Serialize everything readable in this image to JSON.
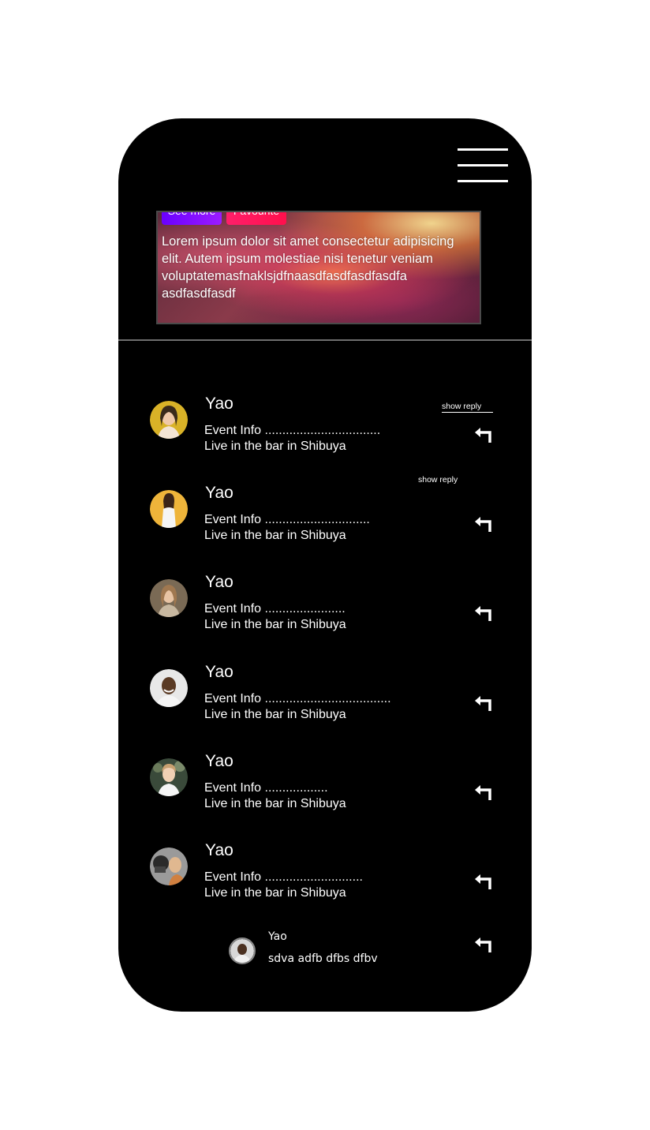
{
  "banner": {
    "see_more_label": "See more",
    "favourite_label": "Favourite",
    "description": "Lorem ipsum dolor sit amet consectetur adipisicing elit. Autem ipsum molestiae nisi tenetur veniam voluptatemasfnaklsjdfnaasdfasdfasdfasdfa asdfasdfasdf"
  },
  "comments": [
    {
      "name": "Yao",
      "info": "Event Info .................................",
      "detail": "Live in the bar in Shibuya",
      "show_reply": "show reply",
      "avatar_color": "#d9b227"
    },
    {
      "name": "Yao",
      "info": "Event Info ..............................",
      "detail": "Live in the bar in Shibuya",
      "show_reply": "show reply",
      "avatar_color": "#eeb43a"
    },
    {
      "name": "Yao",
      "info": "Event Info .......................",
      "detail": "Live in the bar in Shibuya",
      "avatar_color": "#7a6a55"
    },
    {
      "name": "Yao",
      "info": "Event Info ....................................",
      "detail": "Live in the bar in Shibuya",
      "avatar_color": "#e8e8e8"
    },
    {
      "name": "Yao",
      "info": "Event Info ..................",
      "detail": "Live in the bar in Shibuya",
      "avatar_color": "#5a6a5a"
    },
    {
      "name": "Yao",
      "info": "Event Info ............................",
      "detail": "Live in the bar in Shibuya",
      "avatar_color": "#8a8a8a"
    }
  ],
  "reply": {
    "name": "Yao",
    "text": "sdva adfb dfbs dfbv",
    "avatar_color": "#d8d8d8"
  },
  "icons": {
    "menu": "hamburger-menu-icon",
    "reply": "reply-arrow-icon"
  }
}
